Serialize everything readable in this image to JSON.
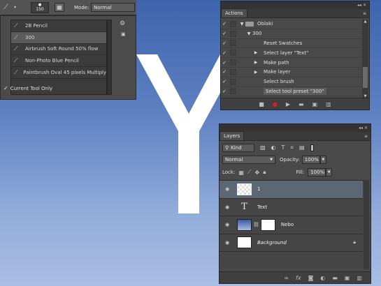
{
  "toolbar": {
    "brush_size": "150",
    "mode_label": "Mode:",
    "mode_value": "Normal"
  },
  "tool_presets": {
    "items": [
      {
        "label": "2B Pencil",
        "selected": false
      },
      {
        "label": "300",
        "selected": true
      },
      {
        "label": "Airbrush Soft Round 50% flow",
        "selected": false
      },
      {
        "label": "Non-Photo Blue Pencil",
        "selected": false
      },
      {
        "label": "Paintbrush Oval 45 pixels Multiply",
        "selected": false
      }
    ],
    "current_tool_only_label": "Current Tool Only",
    "current_tool_only_checked": true
  },
  "canvas": {
    "letter": "Y",
    "background_top": "#3e64ad",
    "background_bottom": "#a9bde4",
    "letter_color": "#ffffff"
  },
  "actions": {
    "tab_label": "Actions",
    "rows": [
      {
        "label": "Oblaki",
        "type": "set",
        "arrow": "expanded"
      },
      {
        "label": "300",
        "type": "action",
        "arrow": "expanded"
      },
      {
        "label": "Reset Swatches",
        "type": "step",
        "arrow": "none"
      },
      {
        "label": "Select layer \"Text\"",
        "type": "step",
        "arrow": "collapsed"
      },
      {
        "label": "Make path",
        "type": "step",
        "arrow": "collapsed"
      },
      {
        "label": "Make layer",
        "type": "step",
        "arrow": "collapsed"
      },
      {
        "label": "Select brush",
        "type": "step",
        "arrow": "none"
      },
      {
        "label": "Select tool preset \"300\"",
        "type": "step",
        "arrow": "none",
        "selected": true
      }
    ]
  },
  "layers": {
    "tab_label": "Layers",
    "filter_kind": "Kind",
    "blend_mode": "Normal",
    "opacity_label": "Opacity:",
    "opacity_value": "100%",
    "lock_label": "Lock:",
    "fill_label": "Fill:",
    "fill_value": "100%",
    "items": [
      {
        "name": "1",
        "kind": "transparent",
        "selected": true
      },
      {
        "name": "Text",
        "kind": "type"
      },
      {
        "name": "Nebo",
        "kind": "gradient-with-mask"
      },
      {
        "name": "Background",
        "kind": "background",
        "locked": true
      }
    ]
  }
}
